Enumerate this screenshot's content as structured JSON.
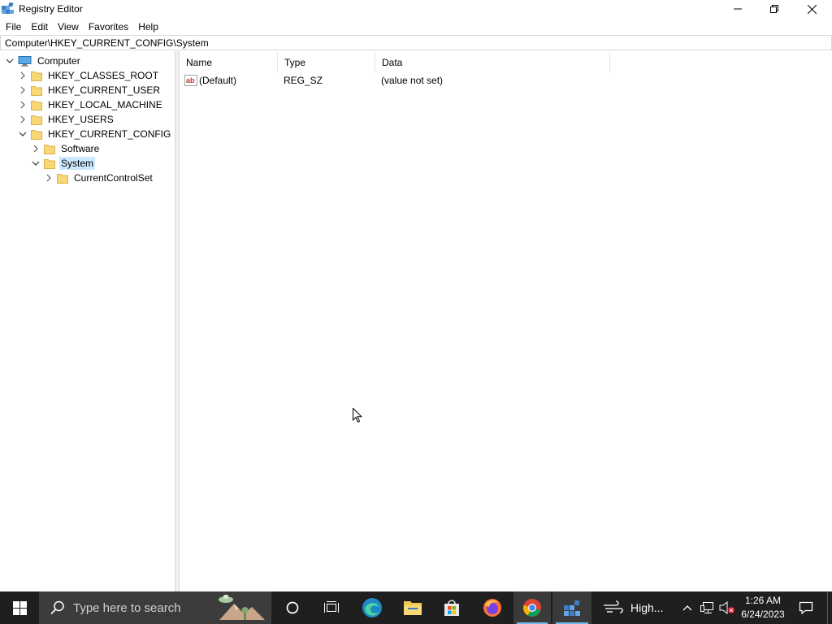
{
  "window": {
    "title": "Registry Editor"
  },
  "menu": {
    "items": [
      "File",
      "Edit",
      "View",
      "Favorites",
      "Help"
    ]
  },
  "address": {
    "path": "Computer\\HKEY_CURRENT_CONFIG\\System"
  },
  "tree": {
    "root": "Computer",
    "hives": [
      "HKEY_CLASSES_ROOT",
      "HKEY_CURRENT_USER",
      "HKEY_LOCAL_MACHINE",
      "HKEY_USERS",
      "HKEY_CURRENT_CONFIG"
    ],
    "config_children": [
      "Software",
      "System"
    ],
    "system_children": [
      "CurrentControlSet"
    ],
    "selected": "System"
  },
  "values": {
    "columns": [
      "Name",
      "Type",
      "Data"
    ],
    "rows": [
      {
        "name": "(Default)",
        "type": "REG_SZ",
        "data": "(value not set)",
        "icon": "string-value-icon"
      }
    ]
  },
  "taskbar": {
    "search_placeholder": "Type here to search",
    "weather": "High...",
    "time": "1:26 AM",
    "date": "6/24/2023",
    "apps": [
      "cortana-icon",
      "task-view-icon",
      "edge-icon",
      "file-explorer-icon",
      "store-icon",
      "firefox-icon",
      "chrome-icon",
      "registry-editor-icon"
    ]
  },
  "colors": {
    "selection": "#cce8ff",
    "taskbar": "#1f1f1f",
    "folder": "#f8d775",
    "accent": "#76b9ed"
  }
}
